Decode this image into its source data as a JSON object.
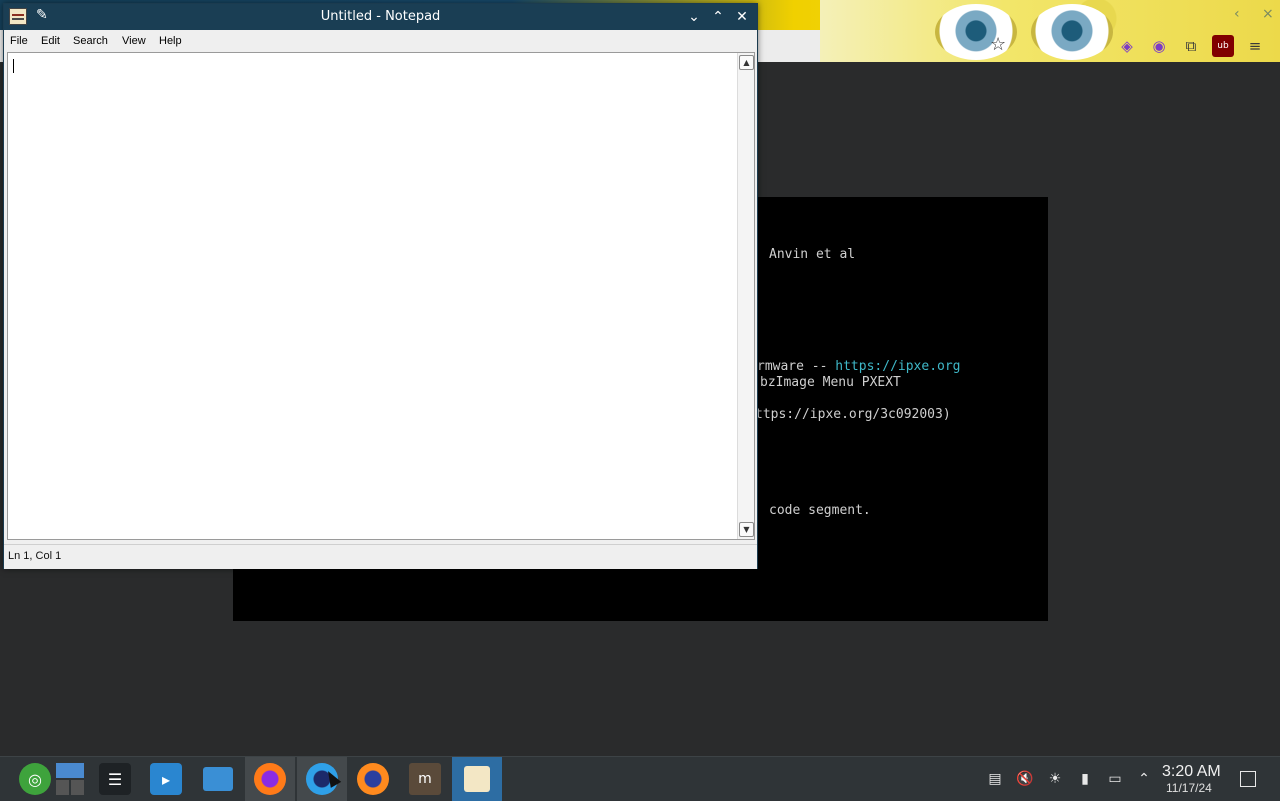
{
  "notepad": {
    "title": "Untitled - Notepad",
    "menu": [
      "File",
      "Edit",
      "Search",
      "View",
      "Help"
    ],
    "status": "Ln 1, Col 1",
    "content": ""
  },
  "console": {
    "lines": [
      "Anvin et al",
      "rmware -- ",
      "bzImage Menu PXEXT",
      "ttps://ipxe.org/3c092003)",
      "code segment."
    ],
    "link": "https://ipxe.org"
  },
  "taskbar": {
    "apps": [
      "opensuse-launcher-icon",
      "desktop-pager-icon",
      "settings-icon",
      "store-icon",
      "files-icon",
      "firefox-icon",
      "browser-icon",
      "firefox-alt-icon",
      "editor-icon",
      "notepad-icon"
    ],
    "time": "3:20 AM",
    "date": "11/17/24"
  },
  "colors": {
    "titlebar": "#1a3e54",
    "taskbar": "#2f3437",
    "active_task": "#2d6da3",
    "link": "#3fb8c8"
  }
}
